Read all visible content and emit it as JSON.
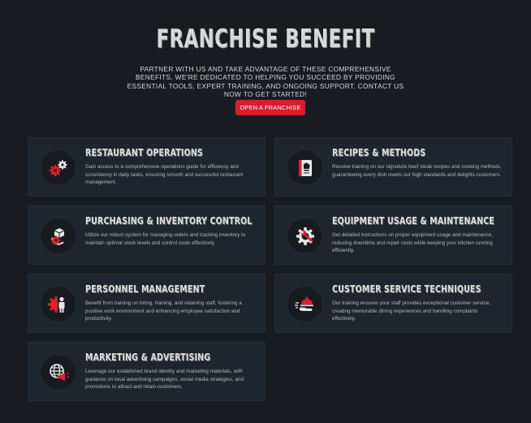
{
  "header": {
    "title": "FRANCHISE BENEFIT",
    "subtitle": "PARTNER WITH US AND TAKE ADVANTAGE OF THESE COMPREHENSIVE BENEFITS. WE'RE DEDICATED TO HELPING YOU SUCCEED BY PROVIDING ESSENTIAL TOOLS, EXPERT TRAINING, AND ONGOING SUPPORT. CONTACT US NOW TO GET STARTED!",
    "cta_label": "OPEN A FRANCHISE"
  },
  "colors": {
    "accent": "#d81e2c",
    "background": "#181c21",
    "card": "#1f252c"
  },
  "benefits": [
    {
      "title": "RESTAURANT OPERATIONS",
      "icon": "gears-icon",
      "description": "Gain access to a comprehensive operations guide for efficiency and consistency in daily tasks, ensuring smooth and successful restaurant management."
    },
    {
      "title": "RECIPES & METHODS",
      "icon": "recipe-book-icon",
      "description": "Receive training on our signature beef steak recipes and cooking methods, guaranteeing every dish meets our high standards and delights customers."
    },
    {
      "title": "PURCHASING & INVENTORY CONTROL",
      "icon": "inventory-icon",
      "description": "Utilize our robust system for managing orders and tracking inventory to maintain optimal stock levels and control costs effectively."
    },
    {
      "title": "EQUIPMENT USAGE & MAINTENANCE",
      "icon": "wrench-gear-icon",
      "description": "Get detailed instructions on proper equipment usage and maintenance, reducing downtime and repair costs while keeping your kitchen running efficiently."
    },
    {
      "title": "PERSONNEL MANAGEMENT",
      "icon": "personnel-gear-icon",
      "description": "Benefit from training on hiring, training, and retaining staff, fostering a positive work environment and enhancing employee satisfaction and productivity."
    },
    {
      "title": "CUSTOMER SERVICE TECHNIQUES",
      "icon": "service-cloche-icon",
      "description": "Our training ensures your staff provides exceptional customer service, creating memorable dining experiences and handling complaints effectively."
    },
    {
      "title": "MARKETING & ADVERTISING",
      "icon": "globe-megaphone-icon",
      "description": "Leverage our established brand identity and marketing materials, with guidance on local advertising campaigns, social media strategies, and promotions to attract and retain customers."
    }
  ]
}
